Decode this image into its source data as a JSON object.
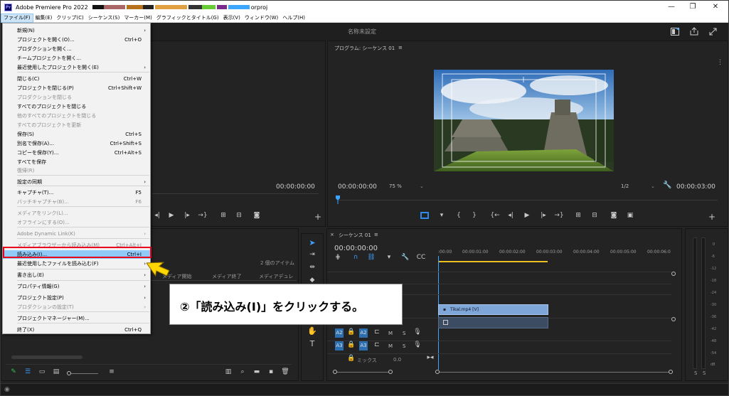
{
  "titlebar": {
    "app_icon": "Pr",
    "title": "Adobe Premiere Pro 2022",
    "filename_suffix": "orproj",
    "minimize": "—",
    "maximize": "❐",
    "close": "✕"
  },
  "menubar": {
    "items": [
      "ファイル(F)",
      "編集(E)",
      "クリップ(C)",
      "シーケンス(S)",
      "マーカー(M)",
      "グラフィックとタイトル(G)",
      "表示(V)",
      "ウィンドウ(W)",
      "ヘルプ(H)"
    ]
  },
  "header": {
    "project_title": "名称未設定"
  },
  "file_menu": {
    "items": [
      {
        "label": "新規(N)",
        "shortcut": "",
        "submenu": true,
        "disabled": false
      },
      {
        "label": "プロジェクトを開く(O)...",
        "shortcut": "Ctrl+O",
        "submenu": false,
        "disabled": false
      },
      {
        "label": "プロダクションを開く...",
        "shortcut": "",
        "submenu": false,
        "disabled": false
      },
      {
        "label": "チームプロジェクトを開く...",
        "shortcut": "",
        "submenu": false,
        "disabled": false
      },
      {
        "label": "最近使用したプロジェクトを開く(E)",
        "shortcut": "",
        "submenu": true,
        "disabled": false
      },
      {
        "label": "閉じる(C)",
        "shortcut": "Ctrl+W",
        "submenu": false,
        "disabled": false
      },
      {
        "label": "プロジェクトを閉じる(P)",
        "shortcut": "Ctrl+Shift+W",
        "submenu": false,
        "disabled": false
      },
      {
        "label": "プロダクションを閉じる",
        "shortcut": "",
        "submenu": false,
        "disabled": true
      },
      {
        "label": "すべてのプロジェクトを閉じる",
        "shortcut": "",
        "submenu": false,
        "disabled": false
      },
      {
        "label": "他のすべてのプロジェクトを閉じる",
        "shortcut": "",
        "submenu": false,
        "disabled": true
      },
      {
        "label": "すべてのプロジェクトを更新",
        "shortcut": "",
        "submenu": false,
        "disabled": true
      },
      {
        "label": "保存(S)",
        "shortcut": "Ctrl+S",
        "submenu": false,
        "disabled": false
      },
      {
        "label": "別名で保存(A)...",
        "shortcut": "Ctrl+Shift+S",
        "submenu": false,
        "disabled": false
      },
      {
        "label": "コピーを保存(Y)...",
        "shortcut": "Ctrl+Alt+S",
        "submenu": false,
        "disabled": false
      },
      {
        "label": "すべてを保存",
        "shortcut": "",
        "submenu": false,
        "disabled": false
      },
      {
        "label": "復帰(R)",
        "shortcut": "",
        "submenu": false,
        "disabled": true
      },
      {
        "label": "設定の同期",
        "shortcut": "",
        "submenu": true,
        "disabled": false
      },
      {
        "label": "キャプチャ(T)...",
        "shortcut": "F5",
        "submenu": false,
        "disabled": false
      },
      {
        "label": "バッチキャプチャ(B)...",
        "shortcut": "F6",
        "submenu": false,
        "disabled": true
      },
      {
        "label": "メディアをリンク(L)...",
        "shortcut": "",
        "submenu": false,
        "disabled": true
      },
      {
        "label": "オフラインにする(O)...",
        "shortcut": "",
        "submenu": false,
        "disabled": true
      },
      {
        "label": "Adobe Dynamic Link(K)",
        "shortcut": "",
        "submenu": true,
        "disabled": true
      },
      {
        "label": "メディアブラウザーから読み込み(M)",
        "shortcut": "Ctrl+Alt+I",
        "submenu": false,
        "disabled": true
      },
      {
        "label": "読み込み(I)...",
        "shortcut": "Ctrl+I",
        "submenu": false,
        "disabled": false,
        "highlighted": true
      },
      {
        "label": "最近使用したファイルを読み込む(F)",
        "shortcut": "",
        "submenu": true,
        "disabled": false
      },
      {
        "label": "書き出し(E)",
        "shortcut": "",
        "submenu": true,
        "disabled": false
      },
      {
        "label": "プロパティ情報(G)",
        "shortcut": "",
        "submenu": true,
        "disabled": false
      },
      {
        "label": "プロジェクト設定(P)",
        "shortcut": "",
        "submenu": true,
        "disabled": false
      },
      {
        "label": "プロダクションの設定(T)",
        "shortcut": "",
        "submenu": true,
        "disabled": true
      },
      {
        "label": "プロジェクトマネージャー(M)...",
        "shortcut": "",
        "submenu": false,
        "disabled": false
      },
      {
        "label": "終了(X)",
        "shortcut": "Ctrl+Q",
        "submenu": false,
        "disabled": false
      }
    ]
  },
  "source_monitor": {
    "timecode": "00:00:00:00"
  },
  "program_monitor": {
    "title": "プログラム: シーケンス 01",
    "timecode_current": "00:00:00:00",
    "zoom": "75 %",
    "resolution": "1/2",
    "timecode_duration": "00:00:03:00"
  },
  "project_panel": {
    "item_count": "2 個のアイテム",
    "columns": [
      "メディア開始",
      "メディア終了",
      "メディアデュレ"
    ]
  },
  "timeline": {
    "tab_label": "シーケンス 01",
    "timecode": "00:00:00:00",
    "ruler": [
      ":00:00",
      "00:00:01:00",
      "00:00:02:00",
      "00:00:03:00",
      "00:00:04:00",
      "00:00:05:00",
      "00:00:06:0"
    ],
    "clip_label": "Tikal.mp4 [V]",
    "audio_tracks": [
      {
        "src": "A2",
        "dst": "A2"
      },
      {
        "src": "A3",
        "dst": "A3"
      }
    ],
    "mix_label": "ミックス",
    "mix_value": "0.0",
    "mute": "M",
    "solo": "S"
  },
  "audio_meter": {
    "labels": [
      "0",
      "-6",
      "-12",
      "-18",
      "-24",
      "-30",
      "-36",
      "-42",
      "-48",
      "-54",
      "dB"
    ],
    "solo_left": "S",
    "solo_right": "S"
  },
  "annotation": {
    "text": "②「読み込み(I)」をクリックする。",
    "arrow_color": "#ffd700",
    "box_color": "#e8001c"
  }
}
